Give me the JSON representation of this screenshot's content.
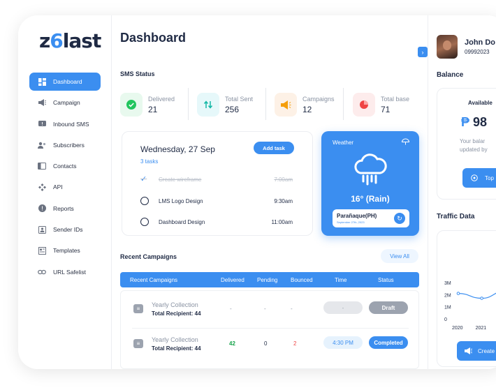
{
  "brand": {
    "logo_left": "z",
    "logo_six": "6",
    "logo_right": "last",
    "accent": "#3b8ef0"
  },
  "sidebar": {
    "items": [
      {
        "label": "Dashboard",
        "icon": "grid-icon"
      },
      {
        "label": "Campaign",
        "icon": "megaphone-icon"
      },
      {
        "label": "Inbound SMS",
        "icon": "inbound-message-icon"
      },
      {
        "label": "Subscribers",
        "icon": "users-icon"
      },
      {
        "label": "Contacts",
        "icon": "contact-card-icon"
      },
      {
        "label": "API",
        "icon": "api-icon"
      },
      {
        "label": "Reports",
        "icon": "report-icon"
      },
      {
        "label": "Sender IDs",
        "icon": "sender-id-icon"
      },
      {
        "label": "Templates",
        "icon": "template-icon"
      },
      {
        "label": "URL Safelist",
        "icon": "link-icon"
      }
    ]
  },
  "header": {
    "title": "Dashboard",
    "collapse_glyph": "›"
  },
  "sms_status": {
    "title": "SMS Status",
    "stats": [
      {
        "label": "Delivered",
        "value": "21",
        "color": "#22c55e"
      },
      {
        "label": "Total Sent",
        "value": "256",
        "color": "#14b8a6"
      },
      {
        "label": "Campaigns",
        "value": "12",
        "color": "#f59e0b"
      },
      {
        "label": "Total base",
        "value": "71",
        "color": "#ef4444"
      }
    ]
  },
  "tasks": {
    "date": "Wednesday, 27 Sep",
    "count": "3 tasks",
    "add_label": "Add task",
    "items": [
      {
        "name": "Create wireframe",
        "time": "7:00am",
        "done": true
      },
      {
        "name": "LMS Logo Design",
        "time": "9:30am",
        "done": false
      },
      {
        "name": "Dashboard Design",
        "time": "11:00am",
        "done": false
      }
    ]
  },
  "weather": {
    "label": "Weather",
    "temp": "16° (Rain)",
    "city": "Parañaque(PH)",
    "date_line": "September 27th, 2023"
  },
  "recent": {
    "title": "Recent Campaigns",
    "view_all": "View All",
    "columns": [
      "Recent Campaigns",
      "Delivered",
      "Pending",
      "Bounced",
      "Time",
      "Status"
    ],
    "rows": [
      {
        "name": "Yearly Collection",
        "recipients": "Total Recipient: 44",
        "delivered": "-",
        "pending": "-",
        "bounced": "-",
        "time": "-",
        "status": "Draft"
      },
      {
        "name": "Yearly Collection",
        "recipients": "Total Recipient: 44",
        "delivered": "42",
        "pending": "0",
        "bounced": "2",
        "time": "4:30 PM",
        "status": "Completed"
      }
    ]
  },
  "user": {
    "name": "John Do",
    "phone": "09992023"
  },
  "balance": {
    "title": "Balance",
    "available": "Available",
    "currency": "₱",
    "amount": "98",
    "note_line1": "Your balar",
    "note_line2": "updated by",
    "topup_label": "Top"
  },
  "traffic": {
    "title": "Traffic Data",
    "create_label": "Create"
  },
  "chart_data": {
    "type": "line",
    "title": "Traffic Data",
    "x": [
      "2020",
      "2021",
      "2"
    ],
    "yticks": [
      "3M",
      "2M",
      "1M",
      "0"
    ],
    "ylim": [
      0,
      3
    ],
    "series": [
      {
        "values": [
          2.1,
          1.7,
          2.3
        ]
      }
    ]
  }
}
